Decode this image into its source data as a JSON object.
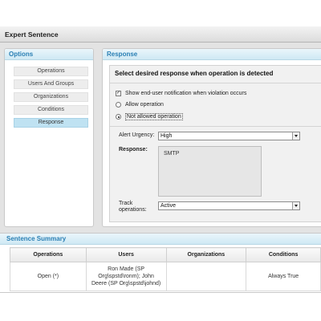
{
  "window": {
    "title": "Expert Sentence"
  },
  "options_panel": {
    "title": "Options",
    "items": [
      {
        "label": "Operations",
        "active": false
      },
      {
        "label": "Users And Groups",
        "active": false
      },
      {
        "label": "Organizations",
        "active": false
      },
      {
        "label": "Conditions",
        "active": false
      },
      {
        "label": "Response",
        "active": true
      }
    ]
  },
  "response_panel": {
    "title": "Response",
    "heading": "Select desired response when operation is detected",
    "notify": {
      "label": "Show end-user notification when violation occurs",
      "checked": true
    },
    "allow": {
      "label": "Allow operation",
      "selected": false
    },
    "not_allowed": {
      "label": "Not allowed operation",
      "selected": true
    },
    "alert_urgency": {
      "label": "Alert Urgency:",
      "value": "High"
    },
    "response": {
      "label": "Response:",
      "value": "SMTP"
    },
    "track": {
      "label_line1": "Track",
      "label_line2": "operations:",
      "value": "Active"
    }
  },
  "summary": {
    "title": "Sentence Summary",
    "columns": [
      "Operations",
      "Users",
      "Organizations",
      "Conditions"
    ],
    "rows": [
      {
        "operations": "Open (*)",
        "users_line1": "Ron Made (SP",
        "users_line2": "Org\\spstd\\ronm); John",
        "users_line3": "Deere (SP Org\\spstd\\johnd)",
        "organizations": "",
        "conditions": "Always True"
      }
    ]
  }
}
